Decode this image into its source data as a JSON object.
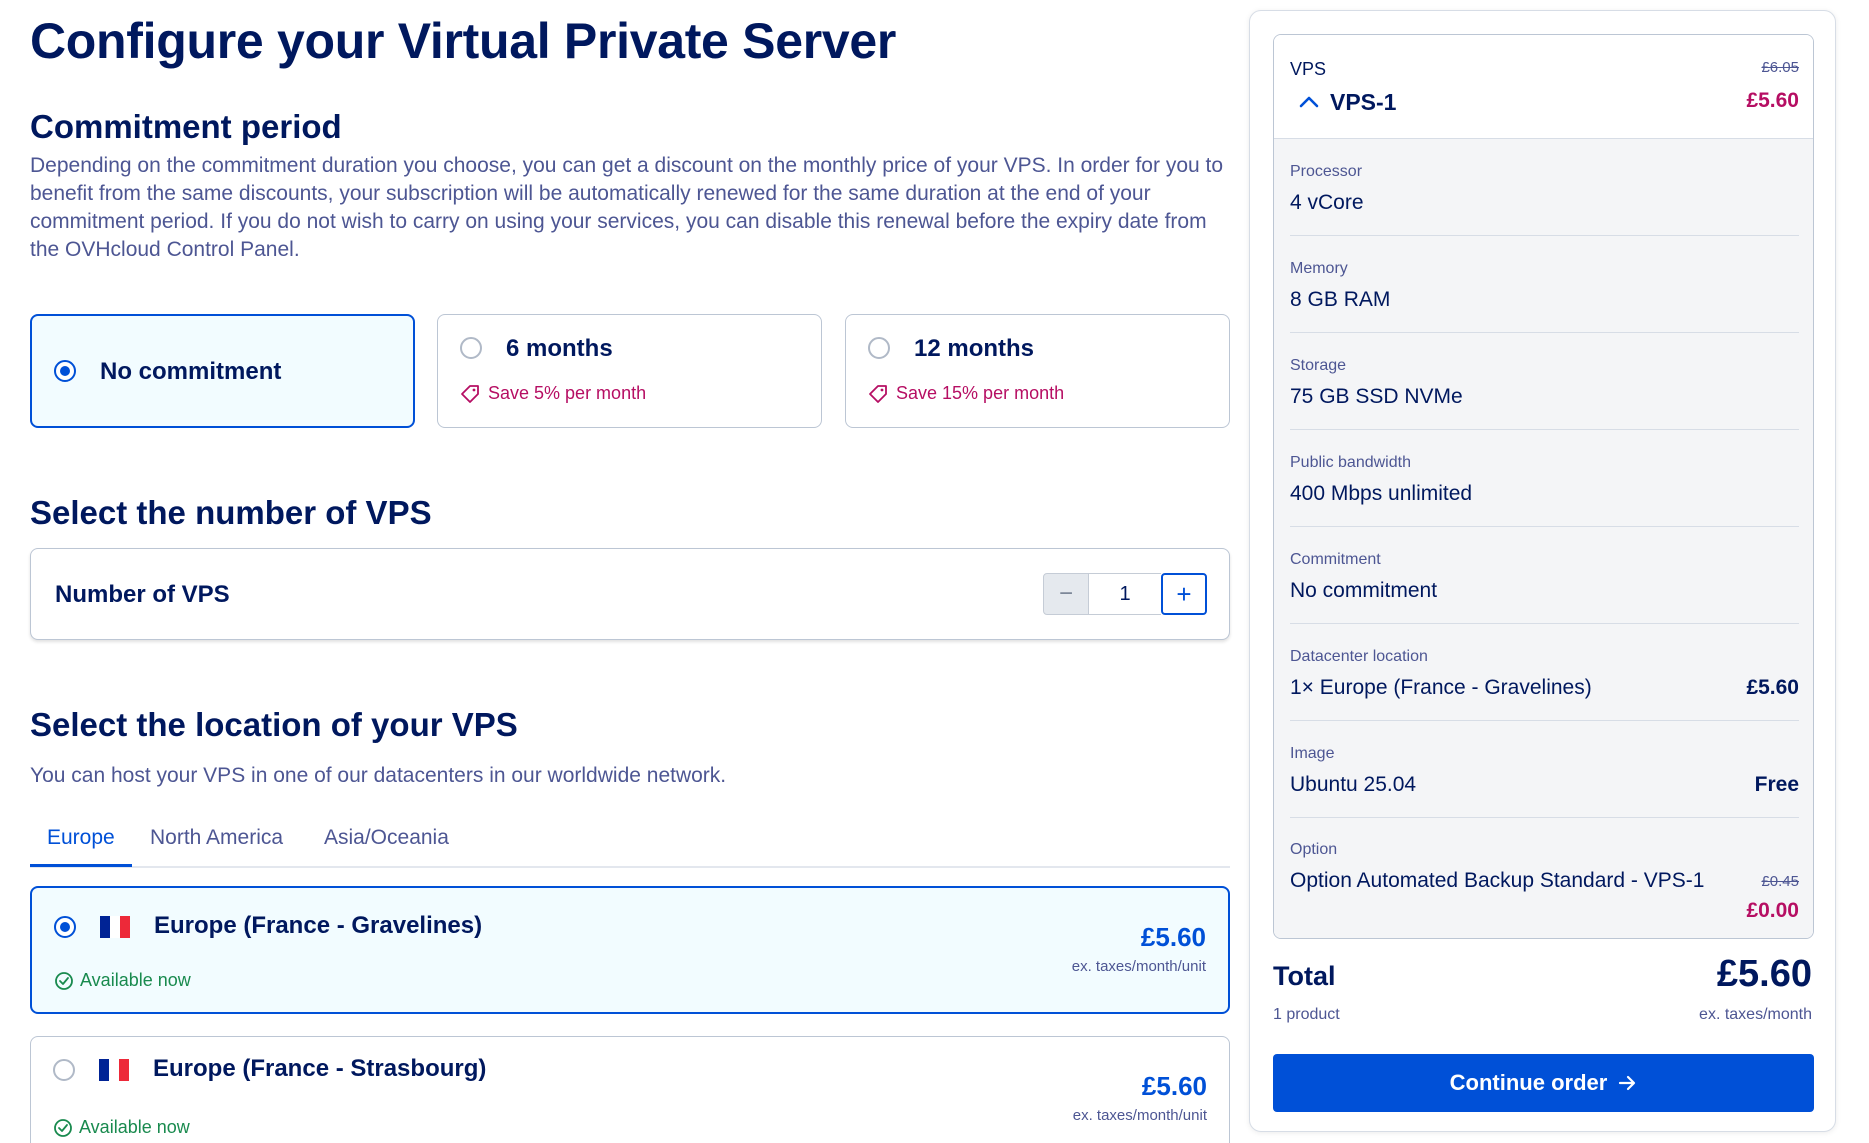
{
  "page_title": "Configure your Virtual Private Server",
  "commitment": {
    "title": "Commitment period",
    "description": "Depending on the commitment duration you choose, you can get a discount on the monthly price of your VPS. In order for you to benefit from the same discounts, your subscription will be automatically renewed for the same duration at the end of your commitment period. If you do not wish to carry on using your services, you can disable this renewal before the expiry date from the OVHcloud Control Panel.",
    "options": [
      {
        "label": "No commitment",
        "save": "",
        "selected": true
      },
      {
        "label": "6 months",
        "save": "Save 5% per month",
        "selected": false
      },
      {
        "label": "12 months",
        "save": "Save 15% per month",
        "selected": false
      }
    ]
  },
  "quantity": {
    "title": "Select the number of VPS",
    "label": "Number of VPS",
    "value": "1",
    "minus": "−",
    "plus": "+"
  },
  "location": {
    "title": "Select the location of your VPS",
    "description": "You can host your VPS in one of our datacenters in our worldwide network.",
    "tabs": [
      "Europe",
      "North America",
      "Asia/Oceania"
    ],
    "active_tab": "Europe",
    "items": [
      {
        "name": "Europe (France - Gravelines)",
        "availability": "Available now",
        "price": "£5.60",
        "unit": "ex. taxes/month/unit",
        "selected": true
      },
      {
        "name": "Europe (France - Strasbourg)",
        "availability": "Available now",
        "price": "£5.60",
        "unit": "ex. taxes/month/unit",
        "selected": false
      }
    ]
  },
  "summary": {
    "category": "VPS",
    "old_price": "£6.05",
    "product": "VPS-1",
    "price": "£5.60",
    "rows": [
      {
        "label": "Processor",
        "value": "4 vCore"
      },
      {
        "label": "Memory",
        "value": "8 GB RAM"
      },
      {
        "label": "Storage",
        "value": "75 GB SSD NVMe"
      },
      {
        "label": "Public bandwidth",
        "value": "400 Mbps unlimited"
      },
      {
        "label": "Commitment",
        "value": "No commitment"
      },
      {
        "label": "Datacenter location",
        "value": "1× Europe (France - Gravelines)",
        "price": "£5.60"
      },
      {
        "label": "Image",
        "value": "Ubuntu 25.04",
        "price": "Free"
      },
      {
        "label": "Option",
        "value": "Option Automated Backup Standard - VPS-1",
        "old_price": "£0.45",
        "price": "£0.00"
      }
    ],
    "total_label": "Total",
    "total_sub": "1 product",
    "total_price": "£5.60",
    "total_unit": "ex. taxes/month",
    "continue_label": "Continue order"
  },
  "colors": {
    "primary": "#0050d7",
    "navy": "#00185e",
    "discount": "#b60e63",
    "available": "#198a4e"
  }
}
